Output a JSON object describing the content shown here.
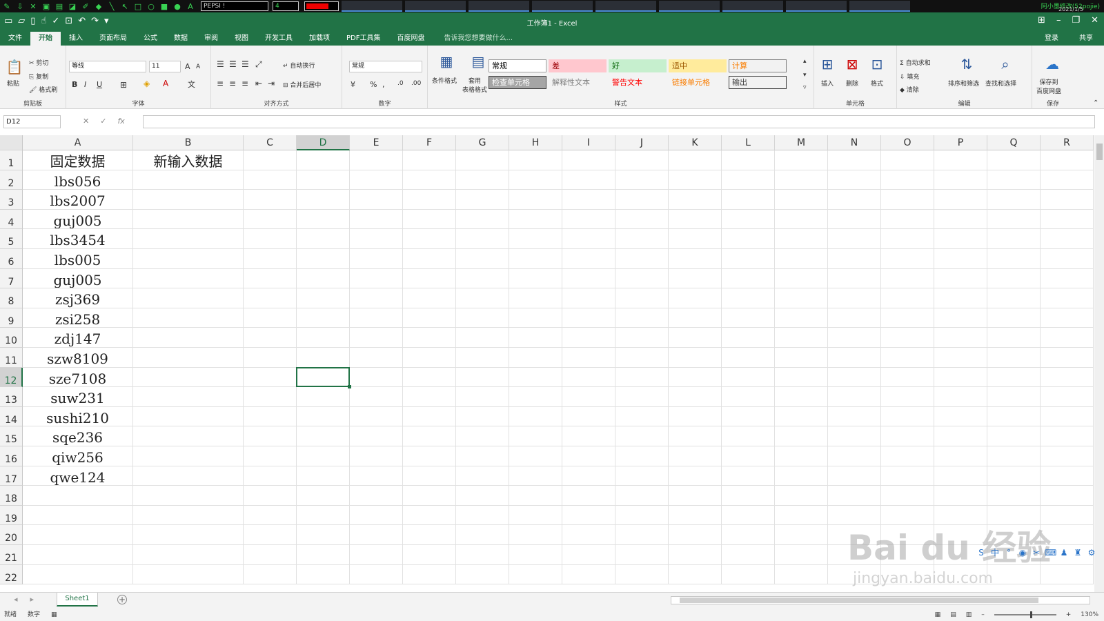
{
  "overlay": {
    "font_name": "PEPSI !",
    "pen_size": "4",
    "pen_color": "#e00000",
    "right_text": "阿小墨修改(52pojie)",
    "right_date": "2021/1/5"
  },
  "window": {
    "title": "工作簿1 - Excel"
  },
  "tabs": [
    "文件",
    "开始",
    "插入",
    "页面布局",
    "公式",
    "数据",
    "审阅",
    "视图",
    "开发工具",
    "加载项",
    "PDF工具集",
    "百度网盘"
  ],
  "active_tab": "开始",
  "tell_me": "告诉我您想要做什么...",
  "login": "登录",
  "share": "共享",
  "ribbon": {
    "clipboard": {
      "paste": "粘贴",
      "cut": "剪切",
      "copy": "复制",
      "format_painter": "格式刷",
      "label": "剪贴板"
    },
    "font": {
      "name": "等线",
      "size": "11",
      "label": "字体"
    },
    "alignment": {
      "wrap": "自动换行",
      "merge": "合并后居中",
      "label": "对齐方式"
    },
    "number": {
      "format": "常规",
      "label": "数字"
    },
    "styles": {
      "conditional": "条件格式",
      "table_format": "套用\n表格格式",
      "cells": [
        {
          "text": "常规",
          "bg": "#ffffff",
          "fg": "#000000",
          "border": "#9a9a9a"
        },
        {
          "text": "差",
          "bg": "#ffc7ce",
          "fg": "#9c0006",
          "border": "transparent"
        },
        {
          "text": "好",
          "bg": "#c6efce",
          "fg": "#006100",
          "border": "transparent"
        },
        {
          "text": "适中",
          "bg": "#ffeb9c",
          "fg": "#9c5700",
          "border": "transparent"
        },
        {
          "text": "计算",
          "bg": "#f2f2f2",
          "fg": "#fa7d00",
          "border": "#7f7f7f"
        },
        {
          "text": "检查单元格",
          "bg": "#a5a5a5",
          "fg": "#ffffff",
          "border": "#3f3f3f"
        },
        {
          "text": "解释性文本",
          "bg": "#f3f3f3",
          "fg": "#7f7f7f",
          "border": "transparent"
        },
        {
          "text": "警告文本",
          "bg": "#f3f3f3",
          "fg": "#ff0000",
          "border": "transparent"
        },
        {
          "text": "链接单元格",
          "bg": "#f3f3f3",
          "fg": "#fa7d00",
          "border": "transparent"
        },
        {
          "text": "输出",
          "bg": "#f2f2f2",
          "fg": "#3f3f3f",
          "border": "#3f3f3f"
        }
      ],
      "label": "样式"
    },
    "cells": {
      "insert": "插入",
      "delete": "删除",
      "format": "格式",
      "label": "单元格"
    },
    "editing": {
      "autosum": "自动求和",
      "fill": "填充",
      "clear": "清除",
      "sort": "排序和筛选",
      "find": "查找和选择",
      "label": "编辑"
    },
    "save": {
      "baidu": "保存到\n百度网盘",
      "label": "保存"
    }
  },
  "formula_bar": {
    "name_box": "D12",
    "formula": ""
  },
  "sheet": {
    "columns": [
      "A",
      "B",
      "C",
      "D",
      "E",
      "F",
      "G",
      "H",
      "I",
      "J",
      "K",
      "L",
      "M",
      "N",
      "O",
      "P",
      "Q",
      "R"
    ],
    "rows": [
      "1",
      "2",
      "3",
      "4",
      "5",
      "6",
      "7",
      "8",
      "9",
      "10",
      "11",
      "12",
      "13",
      "14",
      "15",
      "16",
      "17",
      "18",
      "19",
      "20",
      "21",
      "22"
    ],
    "selected_cell": "D12",
    "col_a": [
      "固定数据",
      "lbs056",
      "lbs2007",
      "guj005",
      "lbs3454",
      "lbs005",
      "guj005",
      "zsj369",
      "zsi258",
      "zdj147",
      "szw8109",
      "sze7108",
      "suw231",
      "sushi210",
      "sqe236",
      "qiw256",
      "qwe124"
    ],
    "col_b": [
      "新输入数据"
    ]
  },
  "sheet_tabs": [
    "Sheet1"
  ],
  "status": {
    "ready": "就绪",
    "mode": "数字",
    "zoom": "130%"
  },
  "watermark": {
    "brand": "Bai du 经验",
    "url": "jingyan.baidu.com"
  }
}
